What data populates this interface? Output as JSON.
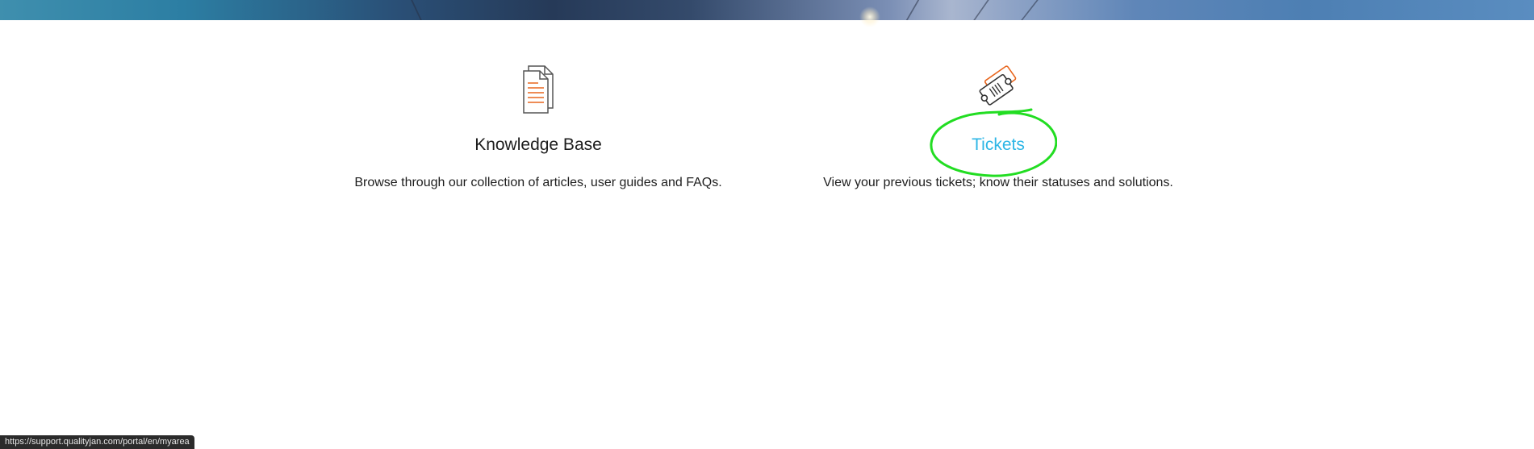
{
  "knowledge_base": {
    "title": "Knowledge Base",
    "description": "Browse through our collection of articles, user guides and FAQs.",
    "icon": "document-stack-icon"
  },
  "tickets": {
    "title": "Tickets",
    "description": "View your previous tickets; know their statuses and solutions.",
    "icon": "ticket-icon",
    "accent_color": "#2db6e6",
    "annotation_color": "#22dd22"
  },
  "status_bar": {
    "url": "https://support.qualityjan.com/portal/en/myarea"
  }
}
